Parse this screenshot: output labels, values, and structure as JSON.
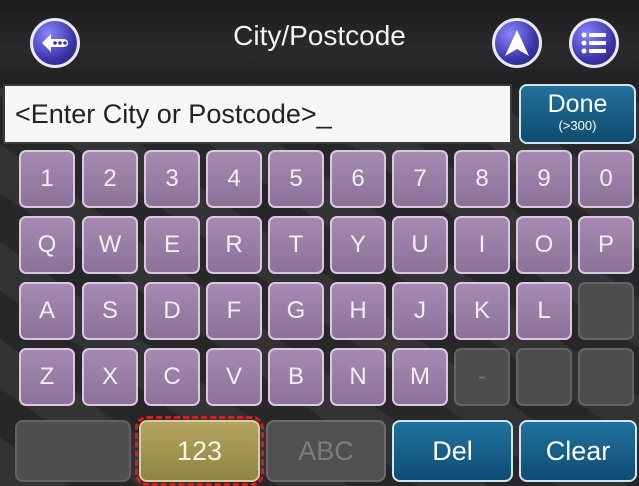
{
  "header": {
    "title": "City/Postcode",
    "back_icon": "back-arrow-icon",
    "nav_icon": "navigation-arrow-icon",
    "menu_icon": "menu-list-icon"
  },
  "input": {
    "value": "<Enter City or Postcode>_"
  },
  "done": {
    "label": "Done",
    "count": "(>300)"
  },
  "keyboard": {
    "rows": [
      [
        "1",
        "2",
        "3",
        "4",
        "5",
        "6",
        "7",
        "8",
        "9",
        "0"
      ],
      [
        "Q",
        "W",
        "E",
        "R",
        "T",
        "Y",
        "U",
        "I",
        "O",
        "P"
      ],
      [
        "A",
        "S",
        "D",
        "F",
        "G",
        "H",
        "J",
        "K",
        "L",
        ""
      ],
      [
        "Z",
        "X",
        "C",
        "V",
        "B",
        "N",
        "M",
        "-",
        "",
        ""
      ]
    ]
  },
  "bottom": {
    "num_label": "123",
    "abc_label": "ABC",
    "del_label": "Del",
    "clear_label": "Clear"
  },
  "colors": {
    "key_fill": "#9d82aa",
    "accent_blue": "#1a6690",
    "mode_yellow": "#a99b52",
    "highlight_red": "#e01919"
  }
}
